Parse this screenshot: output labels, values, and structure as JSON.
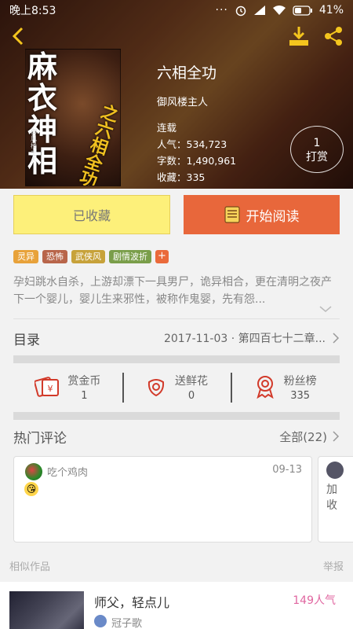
{
  "status_bar": {
    "time": "晚上8:53",
    "dots": "···",
    "battery": "41%"
  },
  "book": {
    "cover_title": "麻衣神相",
    "cover_subtitle": "之六相全功",
    "cover_author": "御风楼主人",
    "title": "六相全功",
    "author": "御风楼主人",
    "status": "连载",
    "popularity": "人气：534,723",
    "word_count": "字数：1,490,961",
    "collections": "收藏：335"
  },
  "tip": {
    "count": "1",
    "label": "打赏"
  },
  "actions": {
    "collected_label": "已收藏",
    "read_label": "开始阅读"
  },
  "tags": [
    {
      "label": "灵异",
      "color": "#e8a23a"
    },
    {
      "label": "恐怖",
      "color": "#b8654a"
    },
    {
      "label": "武侠风",
      "color": "#c7a23a"
    },
    {
      "label": "剧情波折",
      "color": "#7a9e4a"
    }
  ],
  "tag_plus": "+",
  "summary": "孕妇跳水自杀，上游却漂下一具男尸，诡异相合，更在清明之夜产下一个婴儿，婴儿生来邪性，被称作鬼婴，先有怨...",
  "toc": {
    "label": "目录",
    "latest": "2017-11-03 · 第四百七十二章..."
  },
  "stats": [
    {
      "label": "赏金币",
      "value": "1"
    },
    {
      "label": "送鲜花",
      "value": "0"
    },
    {
      "label": "粉丝榜",
      "value": "335"
    }
  ],
  "comments": {
    "title": "热门评论",
    "all_label": "全部(22)",
    "items": [
      {
        "user": "吃个鸡肉",
        "date": "09-13",
        "emoji": "😘"
      }
    ],
    "partial_text": "加收"
  },
  "similar": {
    "label": "相似作品",
    "report": "举报",
    "items": [
      {
        "title": "师父，轻点儿",
        "popularity": "149人气",
        "author": "冠子歌"
      }
    ]
  },
  "colors": {
    "accent": "#e8673b",
    "collected_bg": "#fdf07a",
    "popularity": "#e066a0"
  }
}
